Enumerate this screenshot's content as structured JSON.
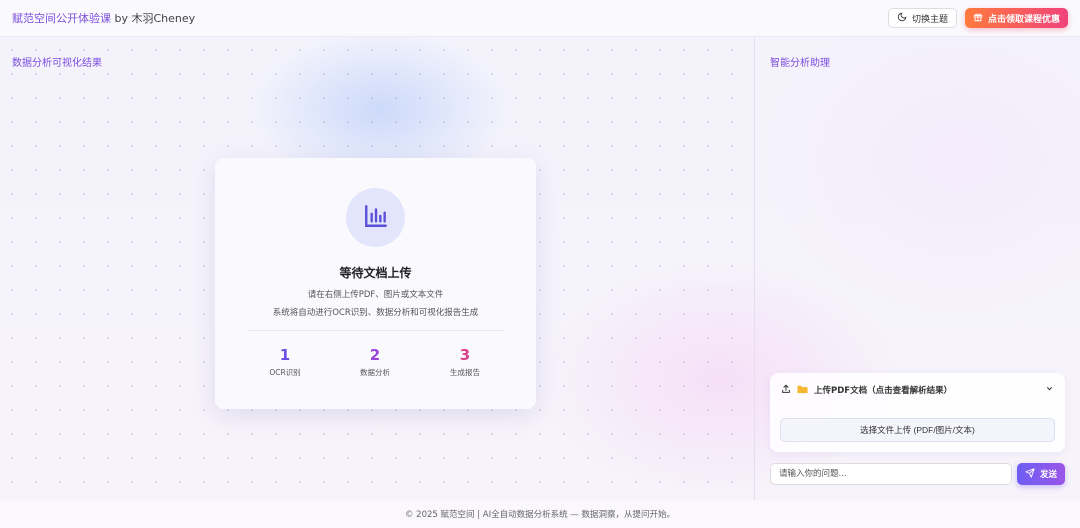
{
  "header": {
    "brand_highlight": "赋范空间公开体验课",
    "brand_rest": " by 木羽Cheney",
    "theme_button": "切换主题",
    "promo_button": "点击领取课程优惠"
  },
  "left_panel": {
    "title": "数据分析可视化结果",
    "card": {
      "icon": "bar-chart-icon",
      "title": "等待文档上传",
      "line1": "请在右侧上传PDF、图片或文本文件",
      "line2": "系统将自动进行OCR识别、数据分析和可视化报告生成",
      "steps": [
        {
          "num": "1",
          "label": "OCR识别",
          "color": "#6a4fe0"
        },
        {
          "num": "2",
          "label": "数据分析",
          "color": "#9a45d8"
        },
        {
          "num": "3",
          "label": "生成报告",
          "color": "#d9418a"
        }
      ]
    }
  },
  "right_panel": {
    "title": "智能分析助理",
    "upload": {
      "header_label": "上传PDF文档（点击查看解析结果）",
      "select_button": "选择文件上传 (PDF/图片/文本)"
    },
    "input_placeholder": "请输入你的问题...",
    "send_button": "发送"
  },
  "footer": {
    "text": "© 2025 赋范空间 | AI全自动数据分析系统 — 数据洞察，从提问开始。"
  },
  "colors": {
    "accent": "#7c4dde",
    "promo_start": "#ff7a3d",
    "promo_end": "#f0437a",
    "send_start": "#6d5ff2",
    "send_end": "#9a55e8"
  }
}
